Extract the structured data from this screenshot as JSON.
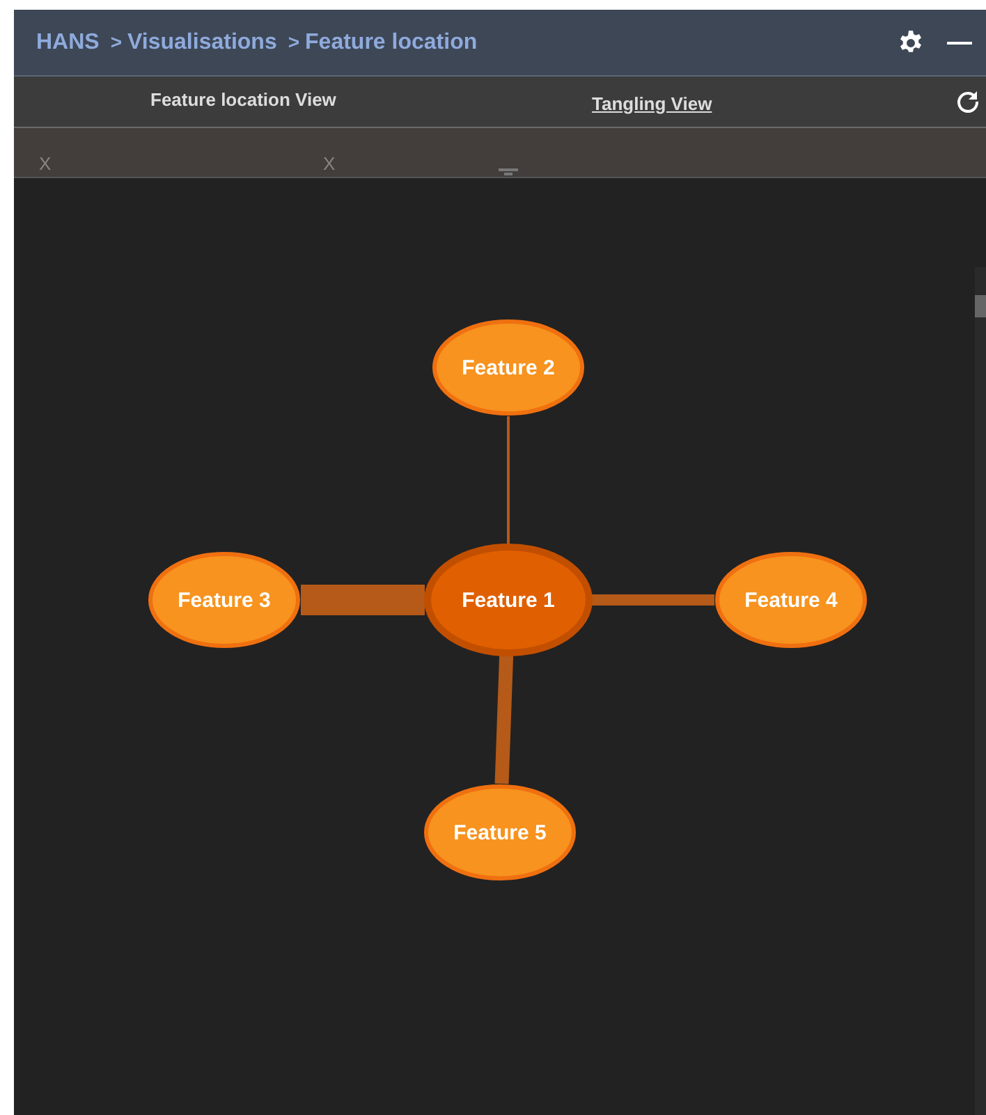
{
  "breadcrumb": [
    {
      "label": "HANS"
    },
    {
      "label": "Visualisations",
      "separator": ">"
    },
    {
      "label": "Feature location",
      "separator": ">"
    }
  ],
  "tabs": [
    {
      "label": "Feature location View",
      "selected": true
    },
    {
      "label": "Tangling View",
      "selected": false
    }
  ],
  "toolbar": {
    "marks": [
      "X",
      "X"
    ]
  },
  "graph": {
    "nodes": [
      {
        "label": "Feature 2",
        "selected": false
      },
      {
        "label": "Feature 3",
        "selected": false
      },
      {
        "label": "Feature 1",
        "selected": true
      },
      {
        "label": "Feature 4",
        "selected": false
      },
      {
        "label": "Feature 5",
        "selected": false
      }
    ]
  }
}
